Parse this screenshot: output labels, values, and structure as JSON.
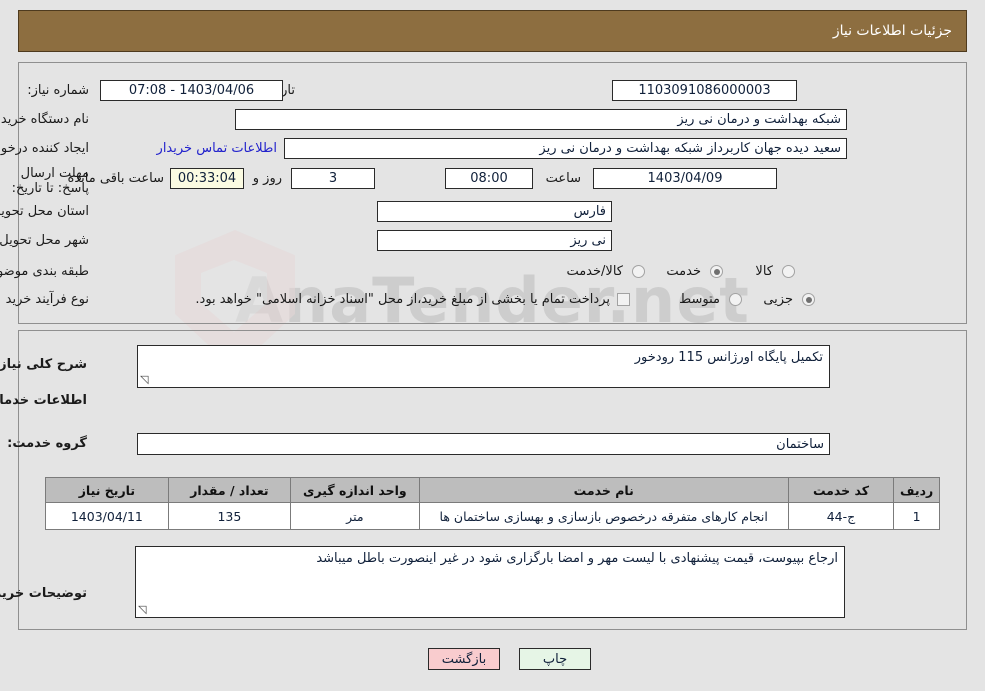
{
  "header": {
    "title": "جزئیات اطلاعات نیاز"
  },
  "fields": {
    "need_number_label": "شماره نیاز:",
    "need_number_value": "1103091086000003",
    "announce_label": "تاریخ و ساعت اعلان عمومی:",
    "announce_value": "1403/04/06 - 07:08",
    "buyer_org_label": "نام دستگاه خریدار:",
    "buyer_org_value": "شبکه بهداشت و درمان نی ریز",
    "creator_label": "ایجاد کننده درخواست:",
    "creator_value": "سعید دیده جهان کاربرداز شبکه بهداشت و درمان نی ریز",
    "contact_link": "اطلاعات تماس خریدار",
    "deadline_label": "مهلت ارسال پاسخ: تا تاریخ:",
    "deadline_date": "1403/04/09",
    "hour_label": "ساعت",
    "deadline_time": "08:00",
    "days_value": "3",
    "days_label": "روز و",
    "timer_value": "00:33:04",
    "timer_label": "ساعت باقی مانده",
    "province_label": "استان محل تحویل:",
    "province_value": "فارس",
    "city_label": "شهر محل تحویل:",
    "city_value": "نی ریز",
    "category_label": "طبقه بندی موضوعی:",
    "category_options": [
      "کالا",
      "خدمت",
      "کالا/خدمت"
    ],
    "category_selected": "خدمت",
    "process_label": "نوع فرآیند خرید :",
    "process_options": [
      "جزیی",
      "متوسط"
    ],
    "process_selected": "جزیی",
    "treasury_text": "پرداخت تمام یا بخشی از مبلغ خرید،از محل \"اسناد خزانه اسلامی\" خواهد بود.",
    "treasury_checked": false
  },
  "summary": {
    "label": "شرح کلی نیاز:",
    "value": "تکمیل پایگاه اورژانس 115 رودخور"
  },
  "services": {
    "section_title": "اطلاعات خدمات مورد نیاز",
    "group_label": "گروه خدمت:",
    "group_value": "ساختمان",
    "columns": [
      "ردیف",
      "کد خدمت",
      "نام خدمت",
      "واحد اندازه گیری",
      "تعداد / مقدار",
      "تاریخ نیاز"
    ],
    "rows": [
      {
        "row": "1",
        "code": "ج-44",
        "name": "انجام کارهای متفرقه درخصوص بازسازی و بهسازی ساختمان ها",
        "unit": "متر",
        "qty": "135",
        "date": "1403/04/11"
      }
    ]
  },
  "notes": {
    "label": "توضیحات خریدار:",
    "value": "ارجاع بپیوست، قیمت پیشنهادی با لیست مهر و امضا بارگزاری شود در غیر اینصورت باطل میباشد"
  },
  "footer": {
    "print_label": "چاپ",
    "back_label": "بازگشت"
  },
  "watermark": {
    "text": "AnaTender.net"
  },
  "colors": {
    "header_brown": "#8d6e40",
    "table_header_gray": "#bdbdbd",
    "link_blue": "#2222cc",
    "timer_bg": "#fbfbe2",
    "print_bg": "#e6f5e6",
    "back_bg": "#f9ccce"
  }
}
